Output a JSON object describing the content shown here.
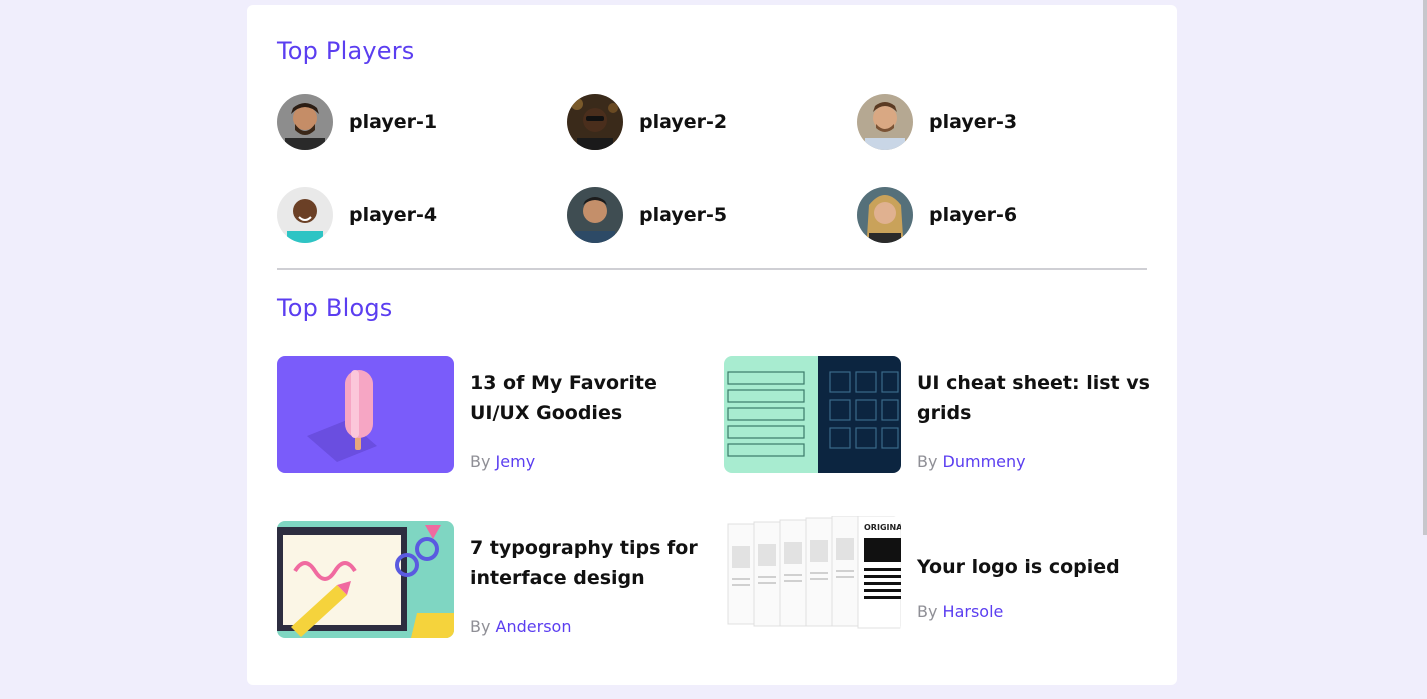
{
  "players_section": {
    "title": "Top Players"
  },
  "players": [
    {
      "name": "player-1"
    },
    {
      "name": "player-2"
    },
    {
      "name": "player-3"
    },
    {
      "name": "player-4"
    },
    {
      "name": "player-5"
    },
    {
      "name": "player-6"
    }
  ],
  "blogs_section": {
    "title": "Top Blogs"
  },
  "blogs": [
    {
      "title": "13 of My Favorite UI/UX Goodies",
      "by": "By",
      "author": "Jemy"
    },
    {
      "title": "UI cheat sheet: list vs grids",
      "by": "By",
      "author": "Dummeny"
    },
    {
      "title": "7 typography tips for interface design",
      "by": "By",
      "author": "Anderson"
    },
    {
      "title": "Your logo is copied",
      "by": "By",
      "author": "Harsole"
    }
  ],
  "thumb_texts": {
    "logo_card": "ORIGINA",
    "logo_card_short": "ORIG"
  },
  "colors": {
    "accent": "#5b3ef0",
    "page_bg": "#f0eefc",
    "card_bg": "#ffffff"
  }
}
